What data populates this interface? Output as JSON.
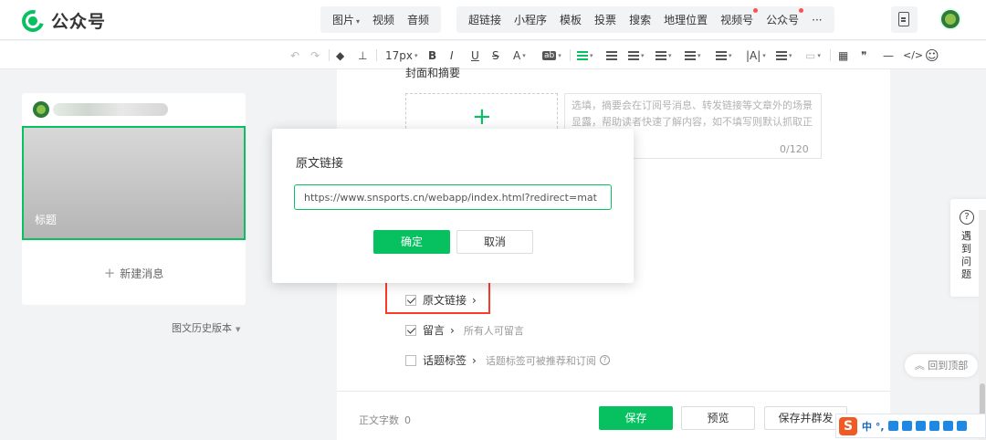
{
  "header": {
    "brand": "公众号",
    "media_items": [
      {
        "label": "图片",
        "caret": "▾"
      },
      {
        "label": "视频"
      },
      {
        "label": "音频"
      }
    ],
    "insert_items": [
      {
        "label": "超链接"
      },
      {
        "label": "小程序"
      },
      {
        "label": "模板"
      },
      {
        "label": "投票"
      },
      {
        "label": "搜索"
      },
      {
        "label": "地理位置"
      },
      {
        "label": "视频号",
        "badge": true
      },
      {
        "label": "公众号",
        "badge": true
      },
      {
        "label": "···"
      }
    ]
  },
  "editor_toolbar": {
    "undo": "↶",
    "redo": "↷",
    "font_size": "17px",
    "bold": "B",
    "italic": "I",
    "underline": "U",
    "strike": "S",
    "font_color": "A",
    "bg_label": "ab",
    "letter_spacing": "|A|",
    "quote": "❞",
    "hr": "—",
    "code": "</>",
    "emoji": "☺"
  },
  "left_panel": {
    "cover_title": "标题",
    "new_message": "新建消息",
    "history_version": "图文历史版本"
  },
  "main": {
    "cover_label": "封面和摘要",
    "upload_plus": "+",
    "abstract_placeholder": "选填，摘要会在订阅号消息、转发链接等文章外的场景显露，帮助读者快速了解内容，如不填写则默认抓取正文前54字",
    "abstract_counter": "0/120",
    "options": [
      {
        "label": "原文链接",
        "arrow": "›",
        "checked": true,
        "desc": ""
      },
      {
        "label": "留言",
        "arrow": "›",
        "checked": true,
        "desc": "所有人可留言"
      },
      {
        "label": "话题标签",
        "arrow": "›",
        "checked": false,
        "desc": "话题标签可被推荐和订阅"
      }
    ]
  },
  "dialog": {
    "title": "原文链接",
    "url_value": "https://www.snsports.cn/webapp/index.html?redirect=mat",
    "confirm": "确定",
    "cancel": "取消"
  },
  "bottom": {
    "word_count_label": "正文字数",
    "word_count_value": "0",
    "save": "保存",
    "preview": "预览",
    "save_publish": "保存并群发"
  },
  "float": {
    "help_icon": "?",
    "help_text": "遇到问题",
    "back_to_top": "回到顶部"
  },
  "ime": {
    "logo": "S",
    "mode": "中 °,"
  },
  "colors": {
    "accent": "#07c160",
    "highlight_border": "#fa3a2a"
  }
}
